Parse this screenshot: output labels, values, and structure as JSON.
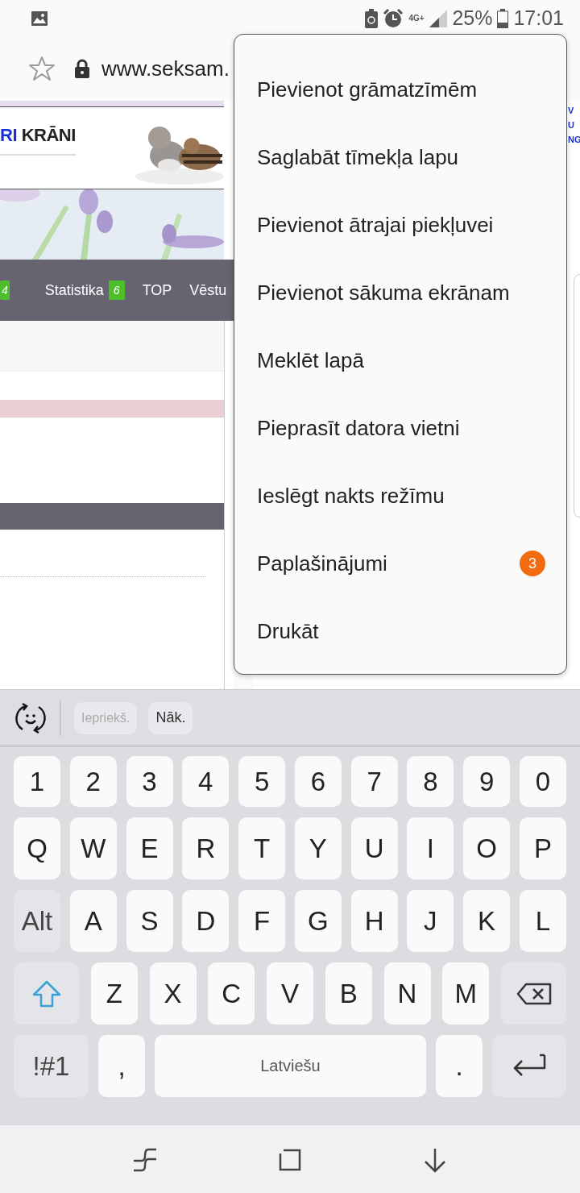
{
  "status_bar": {
    "network": "4G+",
    "battery": "25%",
    "time": "17:01"
  },
  "browser": {
    "url": "www.seksam."
  },
  "page": {
    "logo": {
      "accent": "RI",
      "rest": "KRĀNI"
    },
    "nav": [
      {
        "badge": "4"
      },
      {
        "label": "Statistika",
        "badge": "6"
      },
      {
        "label": "TOP"
      },
      {
        "label": "Vēstu"
      }
    ],
    "side_letters": [
      "V",
      "U",
      "NG"
    ]
  },
  "menu": {
    "items": [
      {
        "label": "Pievienot grāmatzīmēm"
      },
      {
        "label": "Saglabāt tīmekļa lapu"
      },
      {
        "label": "Pievienot ātrajai piekļuvei"
      },
      {
        "label": "Pievienot sākuma ekrānam"
      },
      {
        "label": "Meklēt lapā"
      },
      {
        "label": "Pieprasīt datora vietni"
      },
      {
        "label": "Ieslēgt nakts režīmu"
      },
      {
        "label": "Paplašinājumi",
        "badge": "3",
        "color": "#f26b0f"
      },
      {
        "label": "Drukāt"
      }
    ]
  },
  "toolbar": {
    "prev": {
      "label": "Iepriekš.",
      "disabled": true
    },
    "next": {
      "label": "Nāk.",
      "disabled": false
    }
  },
  "keyboard": {
    "rows": [
      {
        "keys": [
          {
            "kind": "char",
            "label": "1"
          },
          {
            "kind": "char",
            "label": "2"
          },
          {
            "kind": "char",
            "label": "3"
          },
          {
            "kind": "char",
            "label": "4"
          },
          {
            "kind": "char",
            "label": "5"
          },
          {
            "kind": "char",
            "label": "6"
          },
          {
            "kind": "char",
            "label": "7"
          },
          {
            "kind": "char",
            "label": "8"
          },
          {
            "kind": "char",
            "label": "9"
          },
          {
            "kind": "char",
            "label": "0"
          }
        ]
      },
      {
        "keys": [
          {
            "kind": "char",
            "label": "Q"
          },
          {
            "kind": "char",
            "label": "W"
          },
          {
            "kind": "char",
            "label": "E"
          },
          {
            "kind": "char",
            "label": "R"
          },
          {
            "kind": "char",
            "label": "T"
          },
          {
            "kind": "char",
            "label": "Y"
          },
          {
            "kind": "char",
            "label": "U"
          },
          {
            "kind": "char",
            "label": "I"
          },
          {
            "kind": "char",
            "label": "O"
          },
          {
            "kind": "char",
            "label": "P"
          }
        ]
      },
      {
        "keys": [
          {
            "kind": "function",
            "label": "Alt"
          },
          {
            "kind": "char",
            "label": "A"
          },
          {
            "kind": "char",
            "label": "S"
          },
          {
            "kind": "char",
            "label": "D"
          },
          {
            "kind": "char",
            "label": "F"
          },
          {
            "kind": "char",
            "label": "G"
          },
          {
            "kind": "char",
            "label": "H"
          },
          {
            "kind": "char",
            "label": "J"
          },
          {
            "kind": "char",
            "label": "K"
          },
          {
            "kind": "char",
            "label": "L"
          }
        ]
      },
      {
        "keys": [
          {
            "kind": "shift"
          },
          {
            "kind": "char",
            "label": "Z"
          },
          {
            "kind": "char",
            "label": "X"
          },
          {
            "kind": "char",
            "label": "C"
          },
          {
            "kind": "char",
            "label": "V"
          },
          {
            "kind": "char",
            "label": "B"
          },
          {
            "kind": "char",
            "label": "N"
          },
          {
            "kind": "char",
            "label": "M"
          },
          {
            "kind": "backspace"
          }
        ]
      },
      {
        "keys": [
          {
            "kind": "function",
            "label": "!#1"
          },
          {
            "kind": "char",
            "label": ","
          },
          {
            "kind": "space",
            "label": "Latviešu"
          },
          {
            "kind": "char",
            "label": "."
          },
          {
            "kind": "enter"
          }
        ]
      }
    ]
  }
}
